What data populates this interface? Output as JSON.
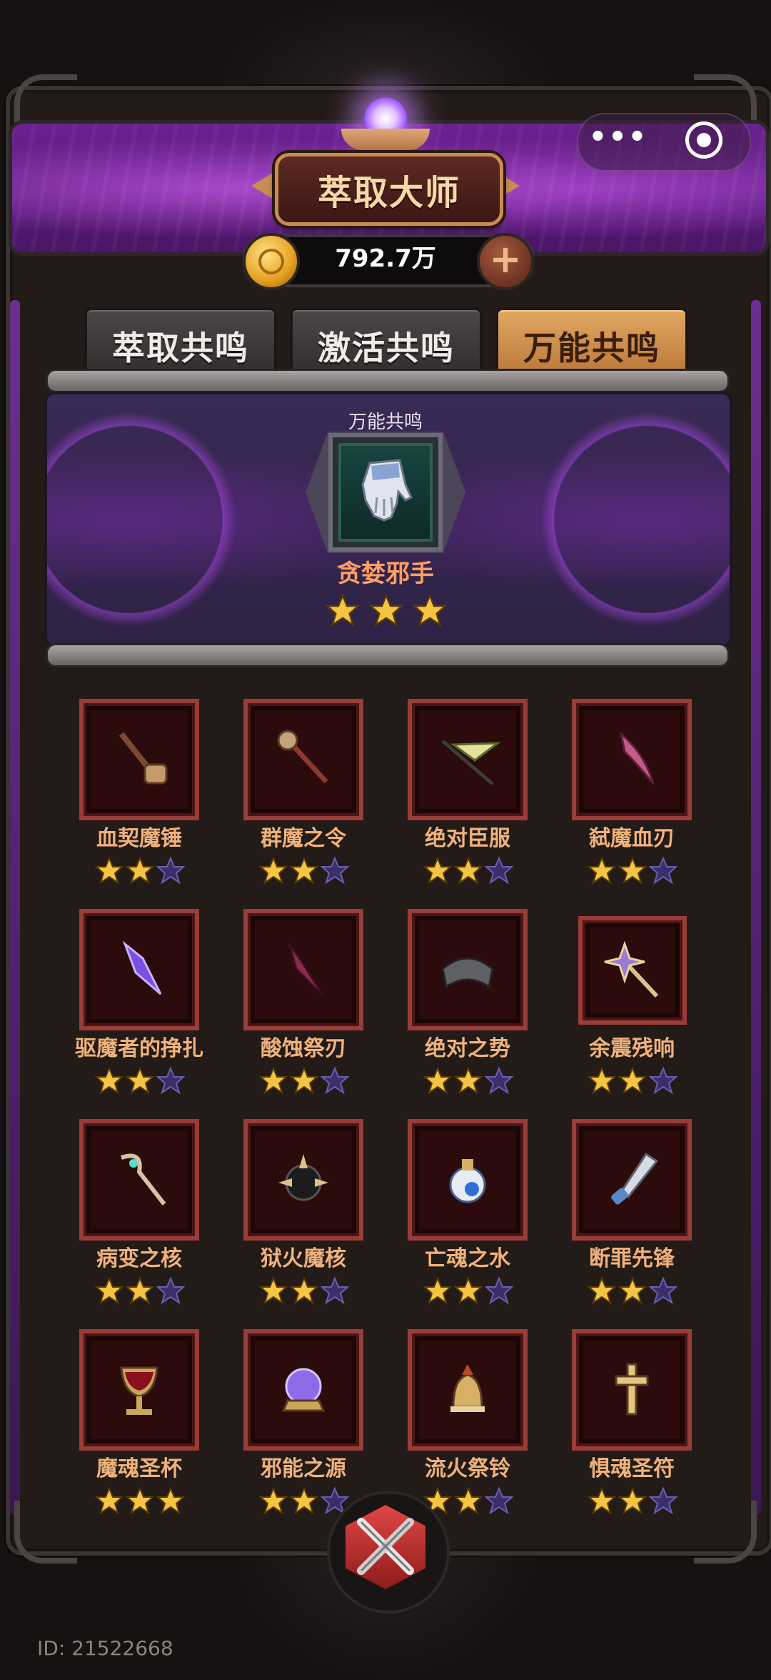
{
  "header": {
    "title": "萃取大师",
    "menu_dots": "•••",
    "close_icon": "target-icon"
  },
  "currency": {
    "amount": "792.7万",
    "coin_icon": "gold-coin-icon",
    "add_icon": "plus-icon"
  },
  "tabs": [
    {
      "label": "萃取共鸣",
      "active": false
    },
    {
      "label": "激活共鸣",
      "active": false
    },
    {
      "label": "万能共鸣",
      "active": true
    }
  ],
  "featured": {
    "label": "万能共鸣",
    "item_name": "贪婪邪手",
    "icon": "gauntlet-icon",
    "stars": 3,
    "max_stars": 3
  },
  "items": [
    {
      "name": "血契魔锤",
      "icon": "hammer-icon",
      "stars": 2
    },
    {
      "name": "群魔之令",
      "icon": "scepter-icon",
      "stars": 2
    },
    {
      "name": "绝对臣服",
      "icon": "banner-spear-icon",
      "stars": 2
    },
    {
      "name": "弑魔血刃",
      "icon": "curved-blade-icon",
      "stars": 2
    },
    {
      "name": "驱魔者的挣扎",
      "icon": "purple-blade-icon",
      "stars": 2
    },
    {
      "name": "酸蚀祭刃",
      "icon": "dagger-icon",
      "stars": 2
    },
    {
      "name": "绝对之势",
      "icon": "bracer-icon",
      "stars": 2
    },
    {
      "name": "余震残响",
      "icon": "star-mace-icon",
      "stars": 2
    },
    {
      "name": "病变之核",
      "icon": "staff-icon",
      "stars": 2
    },
    {
      "name": "狱火魔核",
      "icon": "spiked-core-icon",
      "stars": 2
    },
    {
      "name": "亡魂之水",
      "icon": "potion-icon",
      "stars": 2
    },
    {
      "name": "断罪先锋",
      "icon": "knife-icon",
      "stars": 2
    },
    {
      "name": "魔魂圣杯",
      "icon": "chalice-icon",
      "stars": 3
    },
    {
      "name": "邪能之源",
      "icon": "crystal-orb-icon",
      "stars": 2
    },
    {
      "name": "流火祭铃",
      "icon": "bell-icon",
      "stars": 2
    },
    {
      "name": "惧魂圣符",
      "icon": "cross-icon",
      "stars": 2
    }
  ],
  "close_button": {
    "icon": "crossed-swords-close-icon"
  },
  "user_id": "ID: 21522668",
  "colors": {
    "star_filled": "#f4c542",
    "star_empty": "#3a2f6a",
    "item_frame": "#9a3c38",
    "item_name": "#f0b27b",
    "featured_name": "#ff9e63",
    "active_tab": "#d49a55"
  }
}
